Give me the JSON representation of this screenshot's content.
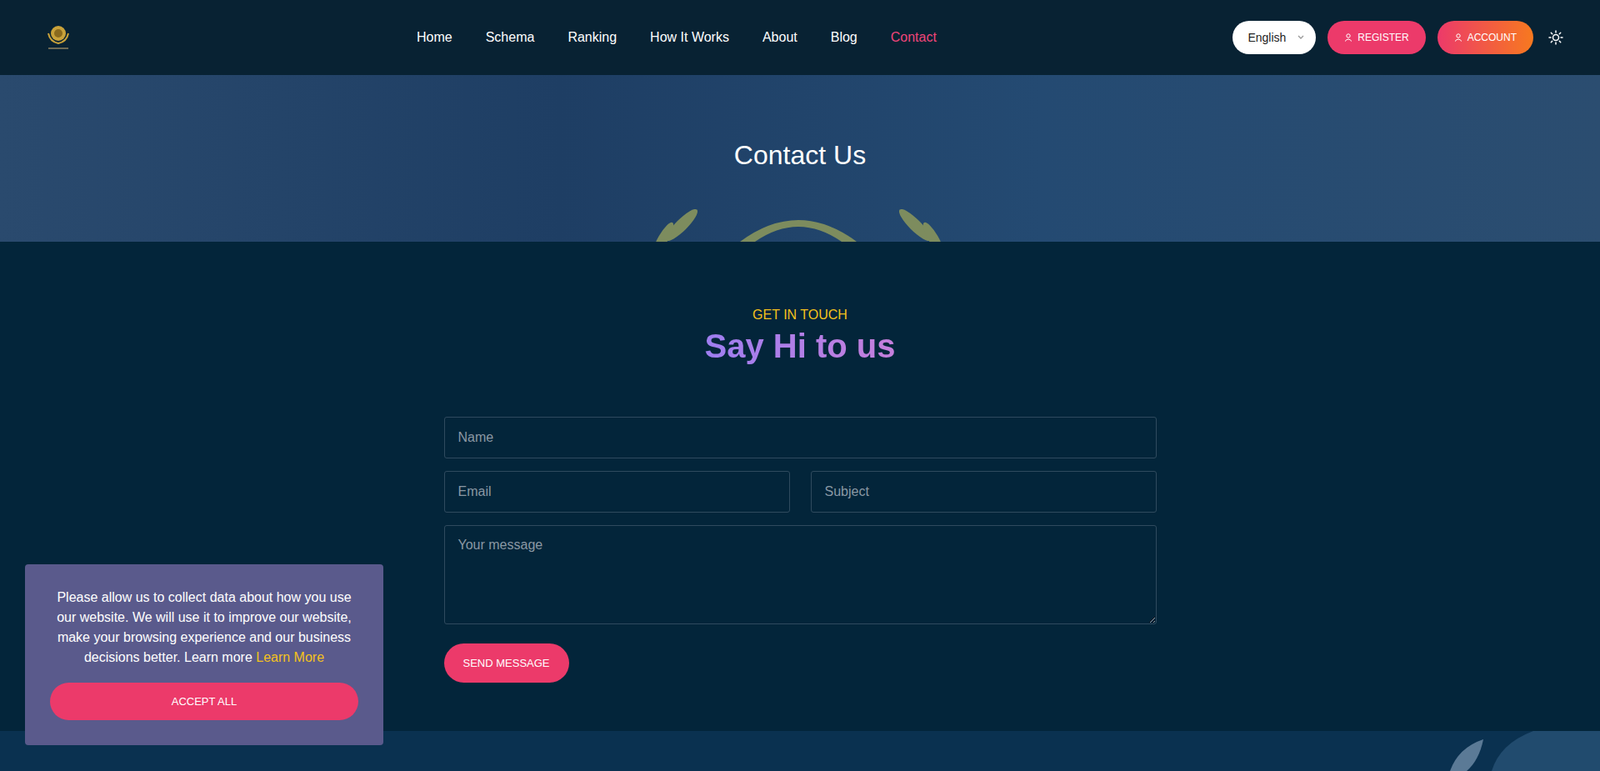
{
  "nav": {
    "items": [
      {
        "label": "Home",
        "selected": false
      },
      {
        "label": "Schema",
        "selected": false
      },
      {
        "label": "Ranking",
        "selected": false
      },
      {
        "label": "How It Works",
        "selected": false
      },
      {
        "label": "About",
        "selected": false
      },
      {
        "label": "Blog",
        "selected": false
      },
      {
        "label": "Contact",
        "selected": true
      }
    ],
    "language": "English",
    "register": "REGISTER",
    "account": "ACCOUNT"
  },
  "hero": {
    "title": "Contact Us"
  },
  "section": {
    "eyebrow": "GET IN TOUCH",
    "heading": "Say Hi to us"
  },
  "form": {
    "name": "Name",
    "email": "Email",
    "subject": "Subject",
    "message": "Your message",
    "submit": "SEND MESSAGE"
  },
  "cookie": {
    "text": "Please allow us to collect data about how you use our website. We will use it to improve our website, make your browsing experience and our business decisions better. Learn more",
    "link": "Learn More",
    "accept": "ACCEPT ALL"
  }
}
